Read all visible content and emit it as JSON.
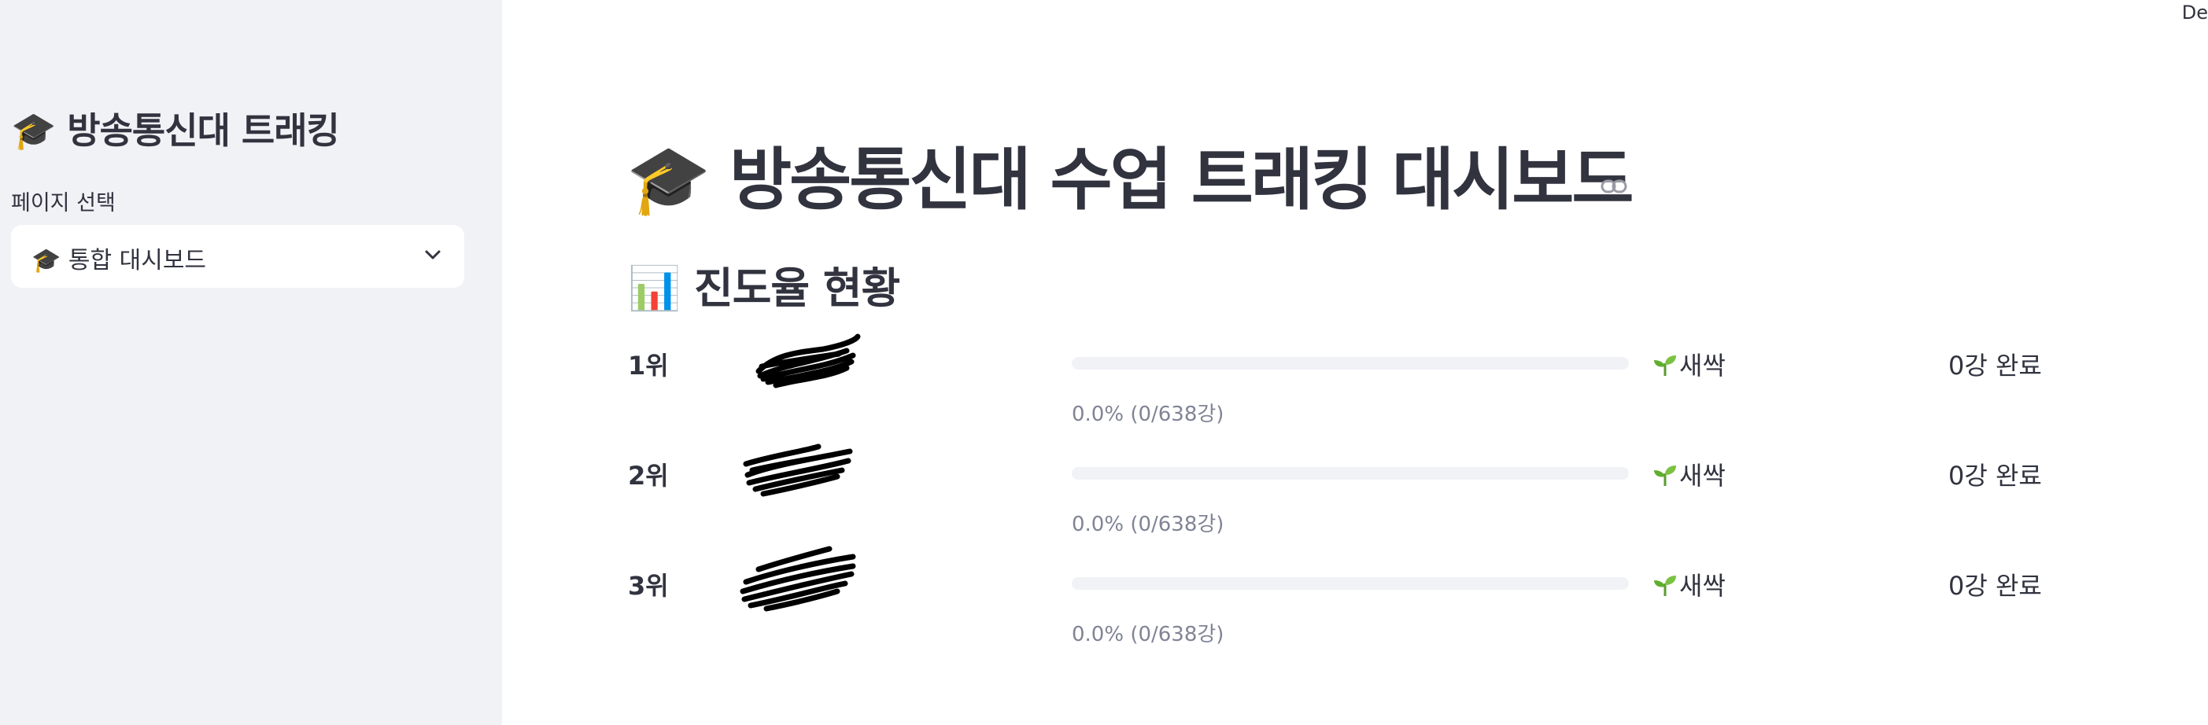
{
  "header": {
    "deploy_label": "De"
  },
  "sidebar": {
    "title": "🎓 방송통신대 트래킹",
    "page_select_label": "페이지 선택",
    "page_select_value": "🎓 통합 대시보드",
    "chevron_icon": "chevron-down-icon"
  },
  "main": {
    "title": "🎓 방송통신대 수업 트래킹 대시보드",
    "section_title": "📊 진도율 현황",
    "rows": [
      {
        "rank": "1위",
        "progress": 0.0,
        "progress_text": "0.0% (0/638강)",
        "badge": "새싹",
        "done": "0강 완료"
      },
      {
        "rank": "2위",
        "progress": 0.0,
        "progress_text": "0.0% (0/638강)",
        "badge": "새싹",
        "done": "0강 완료"
      },
      {
        "rank": "3위",
        "progress": 0.0,
        "progress_text": "0.0% (0/638강)",
        "badge": "새싹",
        "done": "0강 완료"
      }
    ]
  },
  "colors": {
    "sidebar_bg": "#f0f2f6",
    "progress_track": "#f0f2f6",
    "progress_fill": "#ff4b4b",
    "text": "#31333f",
    "muted": "#808495"
  }
}
